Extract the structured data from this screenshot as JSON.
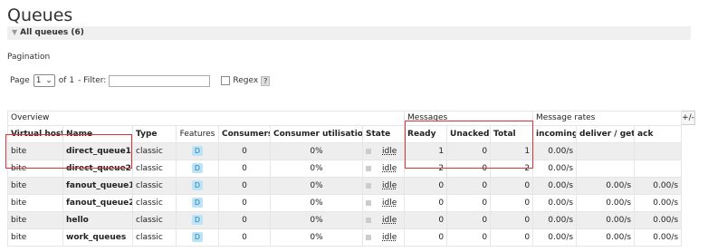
{
  "page": {
    "title": "Queues"
  },
  "section": {
    "label": "All queues (6)"
  },
  "pagination": {
    "label": "Pagination",
    "page_label": "Page",
    "page_value": "1",
    "of_label": "of 1",
    "filter_label": "- Filter:",
    "filter_value": "",
    "regex_label": "Regex",
    "help_label": "?"
  },
  "table": {
    "groups": {
      "overview": "Overview",
      "messages": "Messages",
      "rates": "Message rates",
      "plus": "+/-"
    },
    "headers": {
      "vhost": "Virtual host",
      "name": "Name",
      "type": "Type",
      "features": "Features",
      "consumers": "Consumers",
      "utilisation": "Consumer utilisation",
      "state": "State",
      "ready": "Ready",
      "unacked": "Unacked",
      "total": "Total",
      "incoming": "incoming",
      "deliver": "deliver / get",
      "ack": "ack"
    },
    "rows": [
      {
        "vhost": "bite",
        "name": "direct_queue1",
        "type": "classic",
        "feature": "D",
        "consumers": "0",
        "utilisation": "0%",
        "state": "idle",
        "ready": "1",
        "unacked": "0",
        "total": "1",
        "incoming": "0.00/s",
        "deliver": "",
        "ack": ""
      },
      {
        "vhost": "bite",
        "name": "direct_queue2",
        "type": "classic",
        "feature": "D",
        "consumers": "0",
        "utilisation": "0%",
        "state": "idle",
        "ready": "2",
        "unacked": "0",
        "total": "2",
        "incoming": "0.00/s",
        "deliver": "",
        "ack": ""
      },
      {
        "vhost": "bite",
        "name": "fanout_queue1",
        "type": "classic",
        "feature": "D",
        "consumers": "0",
        "utilisation": "0%",
        "state": "idle",
        "ready": "0",
        "unacked": "0",
        "total": "0",
        "incoming": "0.00/s",
        "deliver": "0.00/s",
        "ack": "0.00/s"
      },
      {
        "vhost": "bite",
        "name": "fanout_queue2",
        "type": "classic",
        "feature": "D",
        "consumers": "0",
        "utilisation": "0%",
        "state": "idle",
        "ready": "0",
        "unacked": "0",
        "total": "0",
        "incoming": "0.00/s",
        "deliver": "0.00/s",
        "ack": "0.00/s"
      },
      {
        "vhost": "bite",
        "name": "hello",
        "type": "classic",
        "feature": "D",
        "consumers": "0",
        "utilisation": "0%",
        "state": "idle",
        "ready": "0",
        "unacked": "0",
        "total": "0",
        "incoming": "0.00/s",
        "deliver": "0.00/s",
        "ack": "0.00/s"
      },
      {
        "vhost": "bite",
        "name": "work_queues",
        "type": "classic",
        "feature": "D",
        "consumers": "0",
        "utilisation": "0%",
        "state": "idle",
        "ready": "0",
        "unacked": "0",
        "total": "0",
        "incoming": "0.00/s",
        "deliver": "0.00/s",
        "ack": "0.00/s"
      }
    ]
  },
  "colors": {
    "highlight": "#d9343a",
    "feature_badge": "#bde4f6",
    "row_alt": "#eeeeee"
  }
}
